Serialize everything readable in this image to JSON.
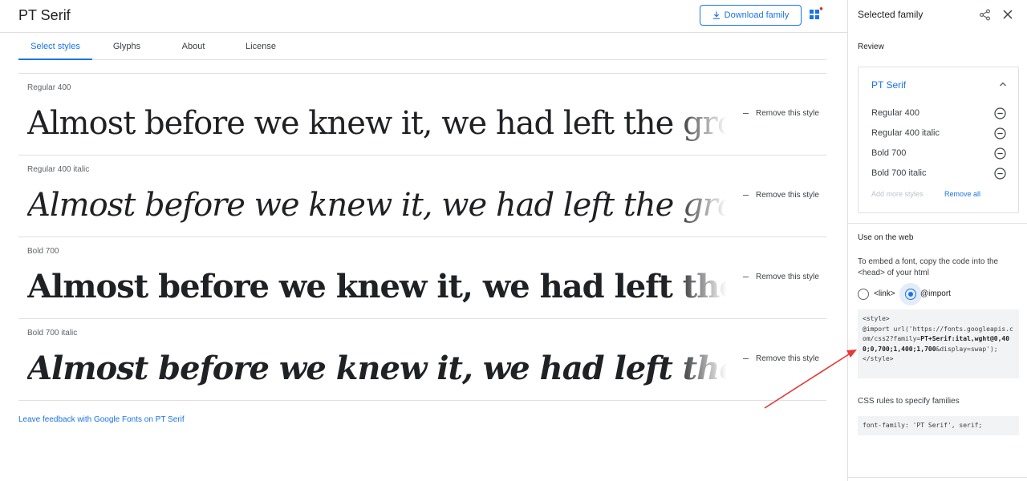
{
  "header": {
    "family_title": "PT Serif",
    "download_label": "Download family"
  },
  "tabs": [
    {
      "label": "Select styles",
      "active": true
    },
    {
      "label": "Glyphs",
      "active": false
    },
    {
      "label": "About",
      "active": false
    },
    {
      "label": "License",
      "active": false
    }
  ],
  "styles": [
    {
      "label": "Regular 400",
      "sample": "Almost before we knew it, we had left the ground.",
      "remove_label": "Remove this style"
    },
    {
      "label": "Regular 400 italic",
      "sample": "Almost before we knew it, we had left the ground.",
      "remove_label": "Remove this style"
    },
    {
      "label": "Bold 700",
      "sample": "Almost before we knew it, we had left the ground.",
      "remove_label": "Remove this style"
    },
    {
      "label": "Bold 700 italic",
      "sample": "Almost before we knew it, we had left the ground.",
      "remove_label": "Remove this style"
    }
  ],
  "feedback_link": "Leave feedback with Google Fonts on PT Serif",
  "panel": {
    "title": "Selected family",
    "review_heading": "Review",
    "review_family": "PT Serif",
    "review_items": [
      "Regular 400",
      "Regular 400 italic",
      "Bold 700",
      "Bold 700 italic"
    ],
    "add_more_label": "Add more styles",
    "remove_all_label": "Remove all",
    "web_heading": "Use on the web",
    "embed_desc": "To embed a font, copy the code into the <head> of your html",
    "radio_link_label": "<link>",
    "radio_import_label": "@import",
    "selected_embed": "@import",
    "code_prefix": "<style>\n@import url('https://fonts.googleapis.com/css2?family=",
    "code_family": "PT+Serif:ital,wght@0,400;0,700;1,400;1,700",
    "code_suffix": "&display=swap');\n</style>",
    "css_heading": "CSS rules to specify families",
    "css_rule": "font-family: 'PT Serif', serif;"
  },
  "colors": {
    "accent": "#1a73e8",
    "annotation_arrow": "#e53935",
    "notification_dot": "#d93025"
  },
  "icons": {
    "download": "download-icon",
    "apps": "apps-add-icon",
    "share": "share-icon",
    "close": "close-icon",
    "collapse": "chevron-up-icon",
    "remove_style": "minus-circle-icon"
  }
}
